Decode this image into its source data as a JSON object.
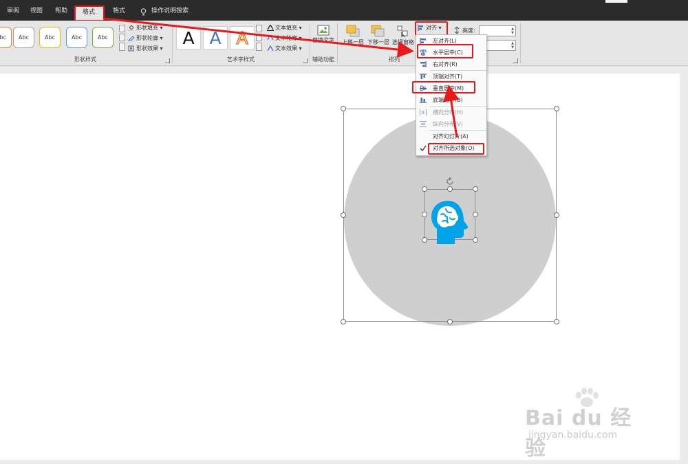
{
  "tabs": [
    {
      "label": "审阅"
    },
    {
      "label": "视图"
    },
    {
      "label": "帮助"
    },
    {
      "label": "格式"
    },
    {
      "label": "格式"
    },
    {
      "label": "操作说明搜索"
    }
  ],
  "ribbon": {
    "shape_styles": {
      "label": "形状样式",
      "preview_text": [
        "Abc",
        "Abc",
        "Abc",
        "Abc",
        "Abc"
      ],
      "preview_colors": [
        "#e07b39",
        "#7f7f7f",
        "#e6b800",
        "#5b9bd5",
        "#70ad47"
      ],
      "fill": "形状填充",
      "outline": "形状轮廓",
      "effects": "形状效果"
    },
    "wordart": {
      "label": "艺术字样式",
      "samples": [
        "A",
        "A",
        "A"
      ],
      "sample_colors": [
        "#111111",
        "#4472c4",
        "#ed7d31"
      ],
      "text_fill": "文本填充",
      "text_outline": "文本轮廓",
      "text_effects": "文本效果"
    },
    "accessibility": {
      "label": "辅助功能",
      "alt_text": "替换文字"
    },
    "arrange": {
      "label": "排列",
      "bring_forward": "上移一层",
      "send_backward": "下移一层",
      "selection_pane": "选择窗格",
      "align": "对齐"
    },
    "size": {
      "height_label": "高度:",
      "height_value": "",
      "width_value": ""
    }
  },
  "align_menu": {
    "items": [
      {
        "label": "左对齐(L)",
        "icon": "align-left-icon",
        "enabled": true
      },
      {
        "label": "水平居中(C)",
        "icon": "align-center-icon",
        "enabled": true
      },
      {
        "label": "右对齐(R)",
        "icon": "align-right-icon",
        "enabled": true
      },
      {
        "label": "顶端对齐(T)",
        "icon": "align-top-icon",
        "enabled": true
      },
      {
        "label": "垂直居中(M)",
        "icon": "align-middle-icon",
        "enabled": true
      },
      {
        "label": "底端对齐(B)",
        "icon": "align-bottom-icon",
        "enabled": true
      },
      {
        "label": "横向分布(H)",
        "icon": "distribute-horizontal-icon",
        "enabled": false
      },
      {
        "label": "纵向分布(V)",
        "icon": "distribute-vertical-icon",
        "enabled": false
      },
      {
        "label": "对齐幻灯片(A)",
        "icon": "",
        "enabled": true
      },
      {
        "label": "对齐所选对象(O)",
        "icon": "check-icon",
        "enabled": true,
        "checked": true
      }
    ]
  },
  "canvas": {
    "circle_color": "#d0cfd0",
    "brain_icon_color": "#00a2e8"
  },
  "annotation_color": "#e8191a",
  "watermark": {
    "logo": "Bai du 经验",
    "url": "jingyan.baidu.com"
  }
}
